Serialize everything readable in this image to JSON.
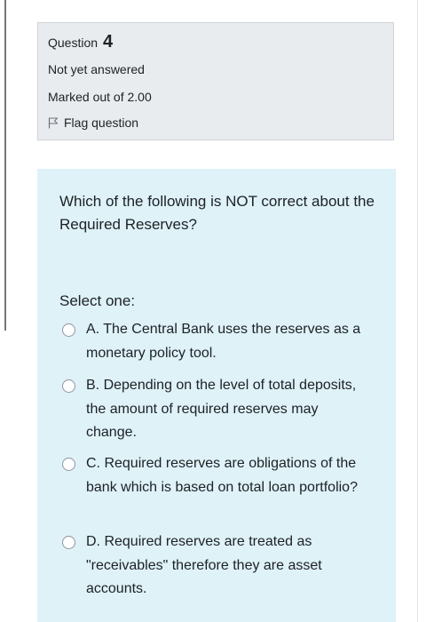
{
  "question": {
    "label": "Question",
    "number": "4",
    "state": "Not yet answered",
    "grade": "Marked out of 2.00",
    "flag_label": "Flag question",
    "text": "Which of the following is NOT correct about the Required Reserves?",
    "select_prompt": "Select one:",
    "options": [
      {
        "text": "A. The Central Bank uses the reserves as a monetary policy tool."
      },
      {
        "text": "B. Depending on the level of total deposits, the amount of required reserves may change."
      },
      {
        "text": "C. Required reserves are obligations of the bank which is based on total loan portfolio?"
      },
      {
        "text": "D. Required reserves are treated as \"receivables\" therefore they are asset accounts."
      }
    ]
  },
  "icons": {
    "flag": "flag-icon"
  },
  "colors": {
    "info_background": "#e9ecef",
    "content_background": "#def2f8"
  }
}
